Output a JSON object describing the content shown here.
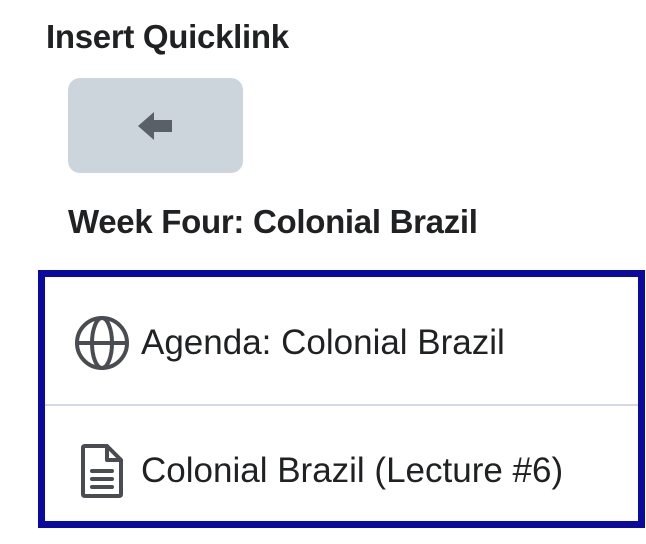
{
  "dialog": {
    "title": "Insert Quicklink"
  },
  "navigation": {
    "back_icon": "arrow-left-icon"
  },
  "section": {
    "heading": "Week Four: Colonial Brazil"
  },
  "items": [
    {
      "label": "Agenda: Colonial Brazil",
      "icon": "globe-icon"
    },
    {
      "label": "Colonial Brazil (Lecture #6)",
      "icon": "document-icon"
    }
  ],
  "colors": {
    "focus_border": "#0b0aa0",
    "back_button_bg": "#cdd5dc",
    "divider": "#d3d9e3",
    "text": "#202122"
  }
}
